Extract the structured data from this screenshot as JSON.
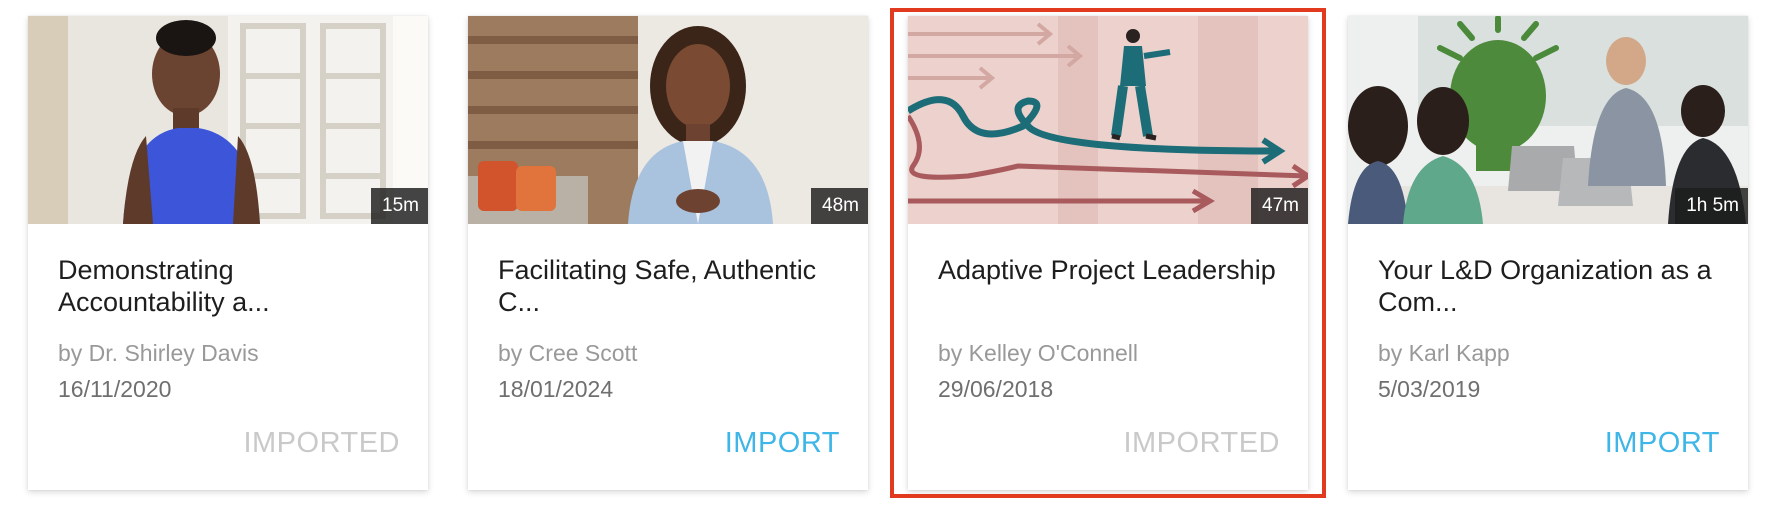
{
  "cards": [
    {
      "title": "Demonstrating Accountability a...",
      "author": "by Dr. Shirley Davis",
      "date": "16/11/2020",
      "duration": "15m",
      "action": "IMPORTED",
      "action_state": "imported",
      "thumbnail_icon": "woman-blue-dress-portrait"
    },
    {
      "title": "Facilitating Safe, Authentic C...",
      "author": "by Cree Scott",
      "date": "18/01/2024",
      "duration": "48m",
      "action": "IMPORT",
      "action_state": "import",
      "thumbnail_icon": "presenter-woman-blazer"
    },
    {
      "title": "Adaptive Project Leadership",
      "author": "by Kelley O'Connell",
      "date": "29/06/2018",
      "duration": "47m",
      "action": "IMPORTED",
      "action_state": "imported",
      "selected": true,
      "thumbnail_icon": "woman-walking-arrows-illustration"
    },
    {
      "title": "Your L&D Organization as a Com...",
      "author": "by Karl Kapp",
      "date": "5/03/2019",
      "duration": "1h 5m",
      "action": "IMPORT",
      "action_state": "import",
      "thumbnail_icon": "meeting-lightbulb-team"
    }
  ],
  "colors": {
    "import_link": "#3fb6e8",
    "imported_text": "#c9c9c9",
    "selection_border": "#e23a1e"
  }
}
